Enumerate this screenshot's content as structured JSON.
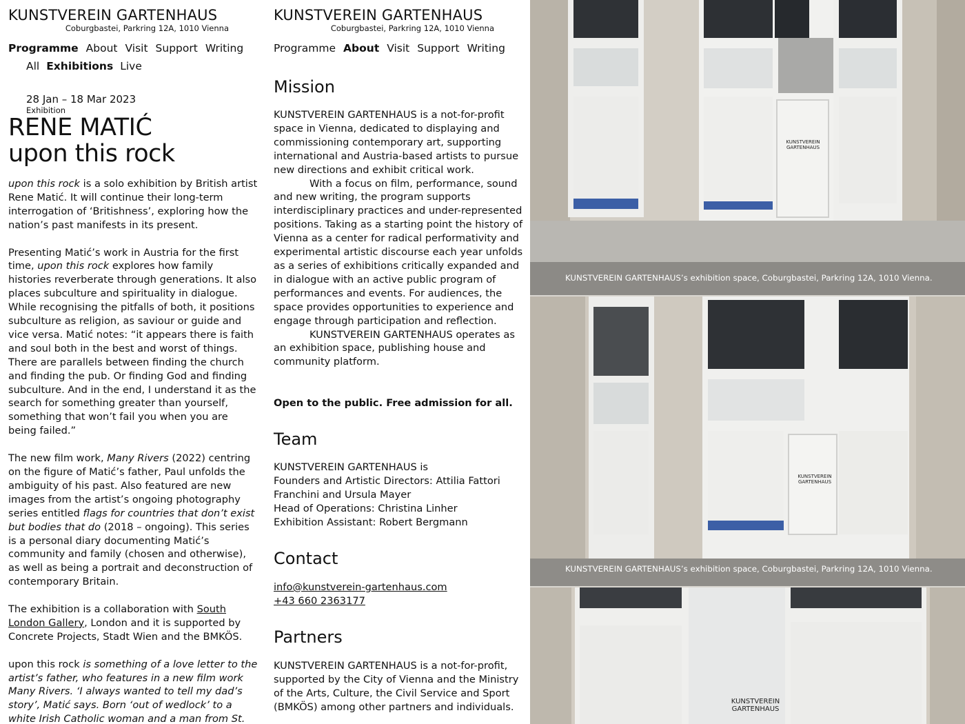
{
  "brand": {
    "title": "KUNSTVEREIN GARTENHAUS",
    "address": "Coburgbastei, Parkring 12A, 1010 Vienna"
  },
  "nav": {
    "items": [
      "Programme",
      "About",
      "Visit",
      "Support",
      "Writing"
    ]
  },
  "left": {
    "active_nav": "Programme",
    "subnav": [
      "All",
      "Exhibitions",
      "Live"
    ],
    "active_subnav": "Exhibitions",
    "dates": "28 Jan – 18 Mar 2023",
    "type": "Exhibition",
    "artist": "RENE MATIĆ",
    "title": "upon this rock",
    "p1_em": "upon this rock",
    "p1_rest": " is a solo exhibition by British artist Rene Matić. It will continue their long-term interrogation of ‘Britishness’, exploring how the nation’s past manifests in its present.",
    "p2_a": "Presenting Matić’s work in Austria for the first time, ",
    "p2_em": "upon this rock",
    "p2_b": " explores how family histories reverberate through generations. It also places subculture and spirituality in dialogue. While recognising the pitfalls of both, it positions subculture as religion, as saviour or guide and vice versa. Matić notes: “it appears there is faith and soul both in the best and worst of things. There are parallels between finding the church and finding the pub. Or finding God and finding subculture. And in the end, I understand it as the search for something greater than yourself, something that won’t fail you when you are being failed.”",
    "p3_a": "The new film work, ",
    "p3_em1": "Many Rivers",
    "p3_b": " (2022) centring on the figure of Matić’s father, Paul unfolds the ambiguity of his past. Also featured are new images from the artist’s ongoing photography series entitled ",
    "p3_em2": "flags for countries that don’t exist but bodies that do",
    "p3_c": " (2018 – ongoing). This series is a personal diary documenting Matić’s community and family (chosen and otherwise), as well as being a portrait and deconstruction of contemporary Britain.",
    "p4_a": "The exhibition is a collaboration with ",
    "p4_link": "South London Gallery",
    "p4_b": ", London and it is supported by Concrete Projects, Stadt Wien and the BMKÖS.",
    "p5_a": "upon this rock",
    "p5_em": " is something of a love letter to the artist’s father, who features in a new film work Many Rivers. ‘I always wanted to tell my dad’s story’, Matić says. Born ‘out of wedlock’ to a white Irish Catholic woman and a man from St."
  },
  "mid": {
    "active_nav": "About",
    "mission_heading": "Mission",
    "mission_p1": "KUNSTVEREIN GARTENHAUS is a not-for-profit space in Vienna, dedicated to displaying and commissioning contemporary art, supporting international and Austria-based artists to pursue new directions and exhibit critical work.",
    "mission_p2": "With a focus on film, performance, sound and new writing, the program supports interdisciplinary practices and under-represented positions. Taking as a starting point the history of Vienna as a center for radical performativity and experimental artistic discourse each year unfolds as a series of exhibitions critically expanded and in dialogue with an active public program of performances and events. For audiences, the space provides opportunities to experience and engage through participation and reflection.",
    "mission_p3": "KUNSTVEREIN GARTENHAUS operates as an exhibition space, publishing house and community platform.",
    "open_note": "Open to the public. Free admission for all.",
    "team_heading": "Team",
    "team_lines": [
      "KUNSTVEREIN GARTENHAUS is",
      "Founders and Artistic Directors: Attilia Fattori Franchini and Ursula Mayer",
      "Head of Operations: Christina Linher",
      "Exhibition Assistant: Robert Bergmann"
    ],
    "contact_heading": "Contact",
    "email": "info@kunstverein-gartenhaus.com",
    "phone": "+43 660 2363177",
    "partners_heading": "Partners",
    "partners_text": "KUNSTVEREIN GARTENHAUS is a not-for-profit, supported by the City of Vienna and the Ministry of the Arts, Culture, the Civil Service and Sport (BMKÖS) among other partners and individuals."
  },
  "photos": {
    "caption": "KUNSTVEREIN GARTENHAUS’s exhibition space, Coburgbastei, Parkring 12A, 1010 Vienna.",
    "door_sign_1": "KUNSTVEREIN",
    "door_sign_2": "GARTENHAUS"
  },
  "colors": {
    "text": "#111111",
    "stone": "#cfc9bf",
    "glass": "#e9ecec",
    "frame": "#f2f2f0",
    "floor": "#3c5fa6"
  }
}
